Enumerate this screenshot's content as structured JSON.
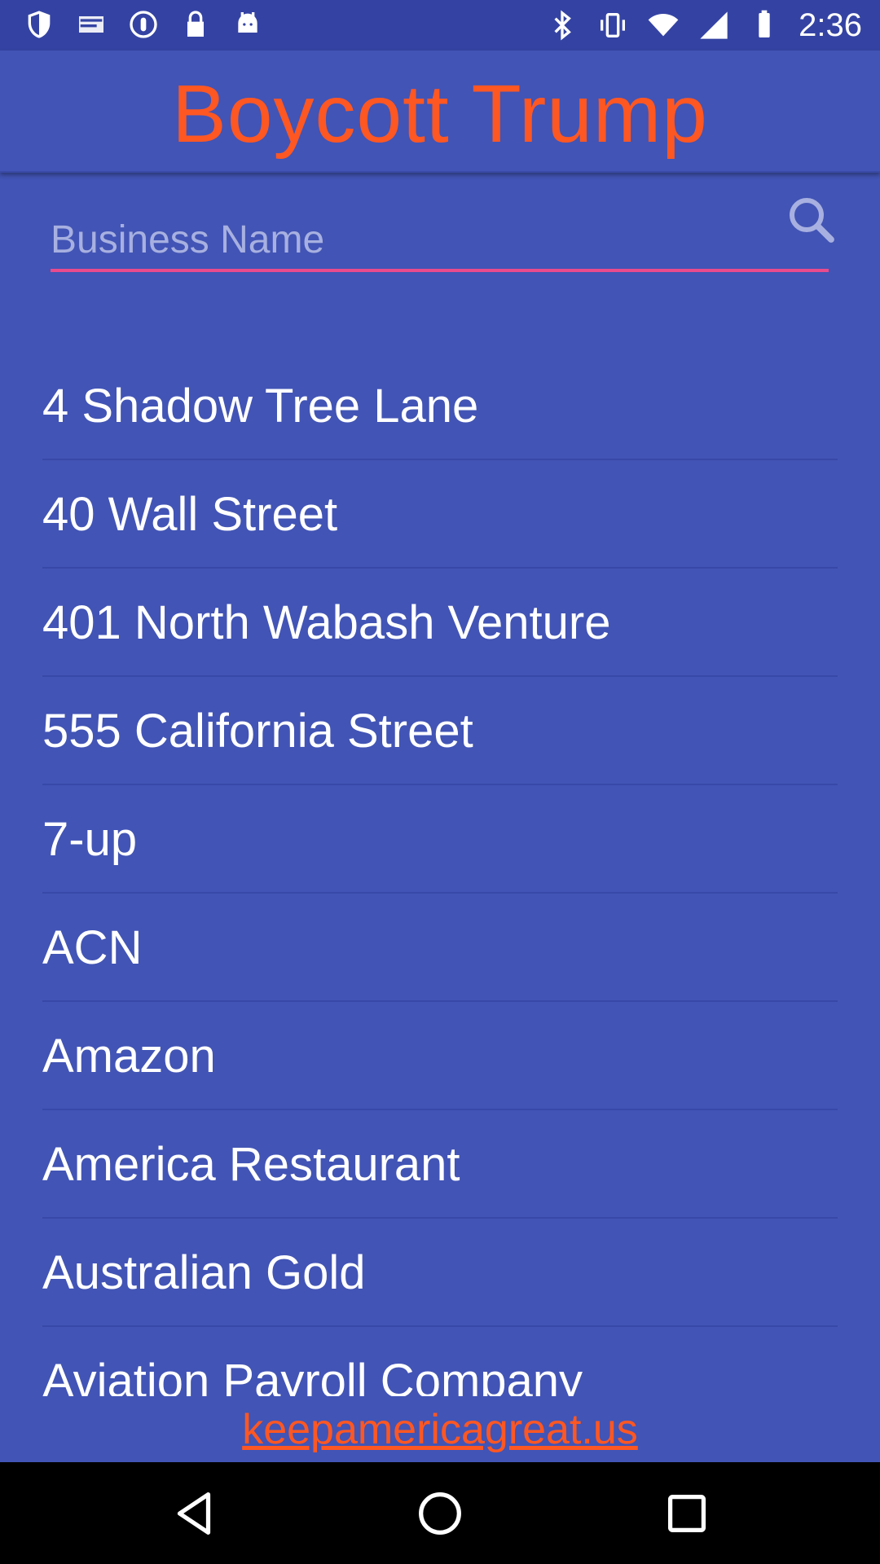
{
  "status_bar": {
    "time": "2:36",
    "left_icons": [
      "shield-icon",
      "mail-icon",
      "info-circle-icon",
      "lock-icon",
      "android-icon"
    ],
    "right_icons": [
      "bluetooth-icon",
      "vibrate-icon",
      "wifi-icon",
      "signal-icon",
      "battery-icon"
    ]
  },
  "header": {
    "title": "Boycott Trump"
  },
  "search": {
    "placeholder": "Business Name",
    "value": ""
  },
  "list": {
    "items": [
      "4 Shadow Tree Lane",
      "40 Wall Street",
      "401 North Wabash Venture",
      "555 California Street",
      "7-up",
      "ACN",
      "Amazon",
      "America Restaurant",
      "Australian Gold",
      "Aviation Payroll Company"
    ]
  },
  "footer": {
    "link_text": "keepamericagreat.us"
  },
  "colors": {
    "background": "#4254b5",
    "accent": "#ff5722",
    "underline": "#e94b8c"
  }
}
